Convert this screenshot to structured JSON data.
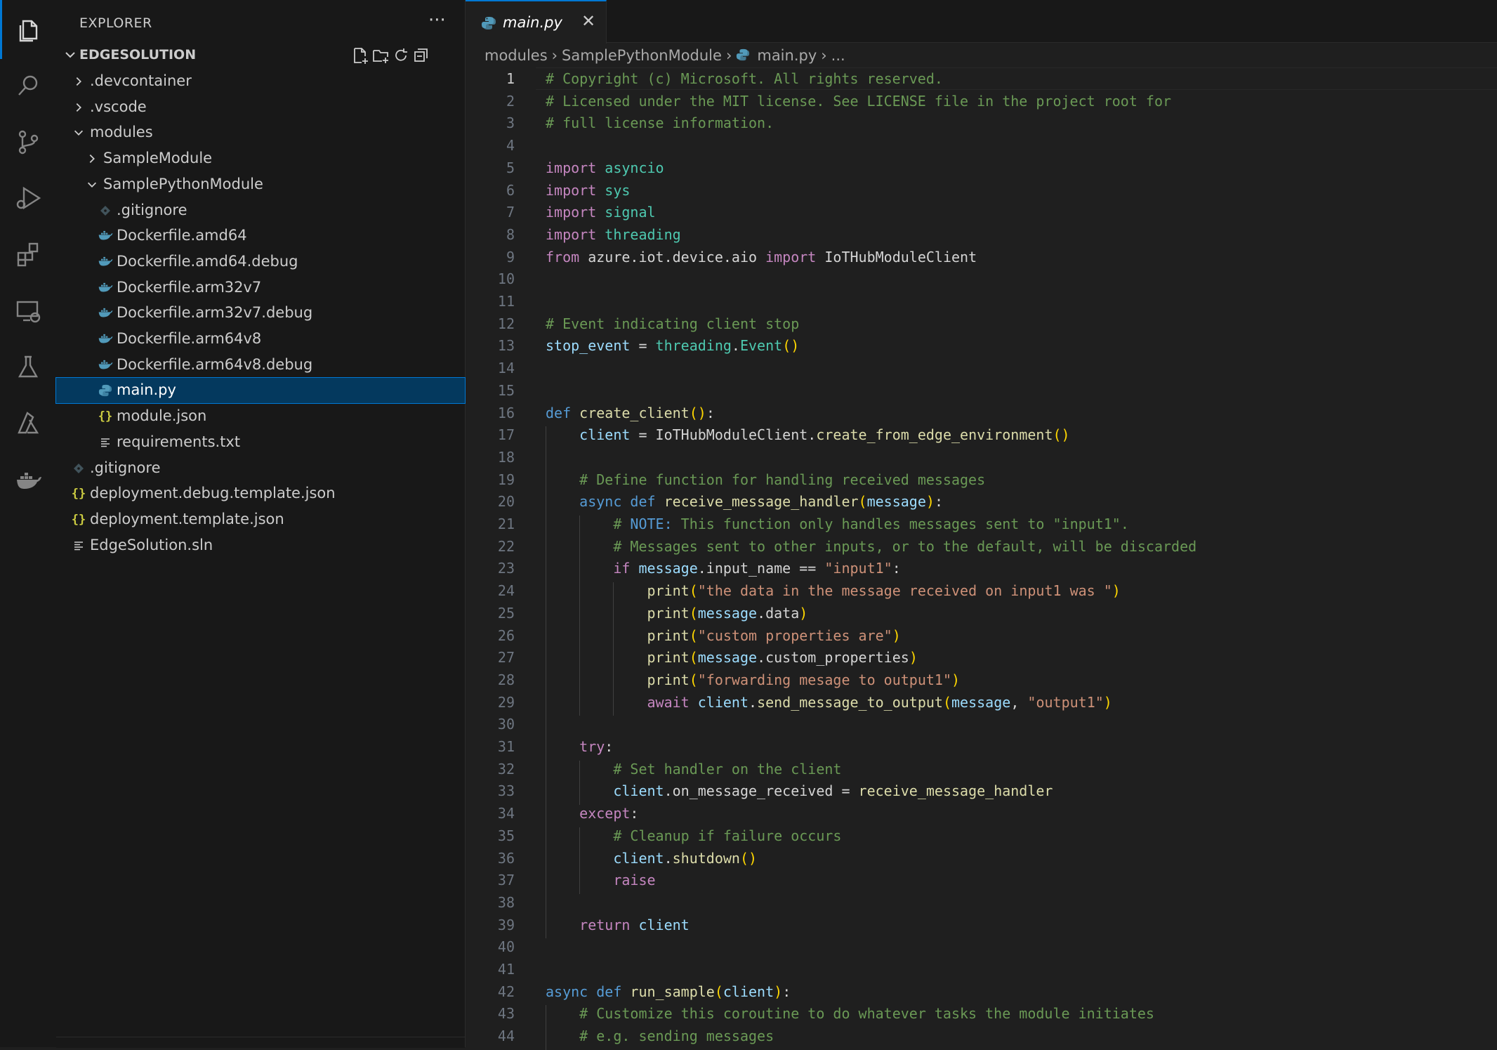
{
  "explorer": {
    "header": "EXPLORER",
    "more": "···",
    "section_title": "EDGESOLUTION",
    "section_actions": [
      "new-file",
      "new-folder",
      "refresh",
      "collapse-all"
    ],
    "tree": [
      {
        "label": ".devcontainer",
        "type": "folder",
        "expanded": false,
        "depth": 1
      },
      {
        "label": ".vscode",
        "type": "folder",
        "expanded": false,
        "depth": 1
      },
      {
        "label": "modules",
        "type": "folder",
        "expanded": true,
        "depth": 1
      },
      {
        "label": "SampleModule",
        "type": "folder",
        "expanded": false,
        "depth": 2
      },
      {
        "label": "SamplePythonModule",
        "type": "folder",
        "expanded": true,
        "depth": 2
      },
      {
        "label": ".gitignore",
        "type": "git",
        "depth": 3
      },
      {
        "label": "Dockerfile.amd64",
        "type": "docker",
        "depth": 3
      },
      {
        "label": "Dockerfile.amd64.debug",
        "type": "docker",
        "depth": 3
      },
      {
        "label": "Dockerfile.arm32v7",
        "type": "docker",
        "depth": 3
      },
      {
        "label": "Dockerfile.arm32v7.debug",
        "type": "docker",
        "depth": 3
      },
      {
        "label": "Dockerfile.arm64v8",
        "type": "docker",
        "depth": 3
      },
      {
        "label": "Dockerfile.arm64v8.debug",
        "type": "docker",
        "depth": 3
      },
      {
        "label": "main.py",
        "type": "python",
        "depth": 3,
        "selected": true
      },
      {
        "label": "module.json",
        "type": "json",
        "depth": 3
      },
      {
        "label": "requirements.txt",
        "type": "text",
        "depth": 3
      },
      {
        "label": ".gitignore",
        "type": "git",
        "depth": 1
      },
      {
        "label": "deployment.debug.template.json",
        "type": "json",
        "depth": 1
      },
      {
        "label": "deployment.template.json",
        "type": "json",
        "depth": 1
      },
      {
        "label": "EdgeSolution.sln",
        "type": "text",
        "depth": 1
      }
    ]
  },
  "activity_bar": [
    "explorer-icon",
    "search-icon",
    "source-control-icon",
    "run-debug-icon",
    "extensions-icon",
    "remote-explorer-icon",
    "testing-icon",
    "azure-icon",
    "docker-icon"
  ],
  "tab": {
    "label": "main.py",
    "close": "✕"
  },
  "breadcrumbs": [
    "modules",
    "SamplePythonModule",
    "main.py",
    "..."
  ],
  "editor": {
    "current_line": 1,
    "lines": [
      {
        "n": "1",
        "t": [
          [
            "c-com",
            "# Copyright (c) Microsoft. All rights reserved."
          ]
        ]
      },
      {
        "n": "2",
        "t": [
          [
            "c-com",
            "# Licensed under the MIT license. See LICENSE file in the project root for"
          ]
        ]
      },
      {
        "n": "3",
        "t": [
          [
            "c-com",
            "# full license information."
          ]
        ]
      },
      {
        "n": "4",
        "t": []
      },
      {
        "n": "5",
        "t": [
          [
            "c-kw",
            "import"
          ],
          [
            "c-txt",
            " "
          ],
          [
            "c-mod",
            "asyncio"
          ]
        ]
      },
      {
        "n": "6",
        "t": [
          [
            "c-kw",
            "import"
          ],
          [
            "c-txt",
            " "
          ],
          [
            "c-mod",
            "sys"
          ]
        ]
      },
      {
        "n": "7",
        "t": [
          [
            "c-kw",
            "import"
          ],
          [
            "c-txt",
            " "
          ],
          [
            "c-mod",
            "signal"
          ]
        ]
      },
      {
        "n": "8",
        "t": [
          [
            "c-kw",
            "import"
          ],
          [
            "c-txt",
            " "
          ],
          [
            "c-mod",
            "threading"
          ]
        ]
      },
      {
        "n": "9",
        "t": [
          [
            "c-kw",
            "from"
          ],
          [
            "c-txt",
            " azure.iot.device.aio "
          ],
          [
            "c-kw",
            "import"
          ],
          [
            "c-txt",
            " IoTHubModuleClient"
          ]
        ]
      },
      {
        "n": "10",
        "t": []
      },
      {
        "n": "11",
        "t": []
      },
      {
        "n": "12",
        "t": [
          [
            "c-com",
            "# Event indicating client stop"
          ]
        ]
      },
      {
        "n": "13",
        "t": [
          [
            "c-var",
            "stop_event"
          ],
          [
            "c-txt",
            " = "
          ],
          [
            "c-mod",
            "threading"
          ],
          [
            "c-txt",
            "."
          ],
          [
            "c-mod",
            "Event"
          ],
          [
            "c-p1",
            "()"
          ]
        ]
      },
      {
        "n": "14",
        "t": []
      },
      {
        "n": "15",
        "t": []
      },
      {
        "n": "16",
        "t": [
          [
            "c-def",
            "def"
          ],
          [
            "c-txt",
            " "
          ],
          [
            "c-fn",
            "create_client"
          ],
          [
            "c-p1",
            "()"
          ],
          [
            "c-txt",
            ":"
          ]
        ]
      },
      {
        "n": "17",
        "t": [
          [
            "c-txt",
            "    "
          ],
          [
            "c-var",
            "client"
          ],
          [
            "c-txt",
            " = "
          ],
          [
            "c-txt",
            "IoTHubModuleClient"
          ],
          [
            "c-txt",
            "."
          ],
          [
            "c-fn",
            "create_from_edge_environment"
          ],
          [
            "c-p1",
            "()"
          ]
        ]
      },
      {
        "n": "18",
        "t": []
      },
      {
        "n": "19",
        "t": [
          [
            "c-txt",
            "    "
          ],
          [
            "c-com",
            "# Define function for handling received messages"
          ]
        ]
      },
      {
        "n": "20",
        "t": [
          [
            "c-txt",
            "    "
          ],
          [
            "c-def",
            "async def"
          ],
          [
            "c-txt",
            " "
          ],
          [
            "c-fn",
            "receive_message_handler"
          ],
          [
            "c-p1",
            "("
          ],
          [
            "c-var",
            "message"
          ],
          [
            "c-p1",
            ")"
          ],
          [
            "c-txt",
            ":"
          ]
        ]
      },
      {
        "n": "21",
        "t": [
          [
            "c-txt",
            "        "
          ],
          [
            "c-com",
            "# "
          ],
          [
            "c-def",
            "NOTE:"
          ],
          [
            "c-com",
            " This function only handles messages sent to \"input1\"."
          ]
        ]
      },
      {
        "n": "22",
        "t": [
          [
            "c-txt",
            "        "
          ],
          [
            "c-com",
            "# Messages sent to other inputs, or to the default, will be discarded"
          ]
        ]
      },
      {
        "n": "23",
        "t": [
          [
            "c-txt",
            "        "
          ],
          [
            "c-kw",
            "if"
          ],
          [
            "c-txt",
            " "
          ],
          [
            "c-var",
            "message"
          ],
          [
            "c-txt",
            ".input_name == "
          ],
          [
            "c-str",
            "\"input1\""
          ],
          [
            "c-txt",
            ":"
          ]
        ]
      },
      {
        "n": "24",
        "t": [
          [
            "c-txt",
            "            "
          ],
          [
            "c-fn",
            "print"
          ],
          [
            "c-p1",
            "("
          ],
          [
            "c-str",
            "\"the data in the message received on input1 was \""
          ],
          [
            "c-p1",
            ")"
          ]
        ]
      },
      {
        "n": "25",
        "t": [
          [
            "c-txt",
            "            "
          ],
          [
            "c-fn",
            "print"
          ],
          [
            "c-p1",
            "("
          ],
          [
            "c-var",
            "message"
          ],
          [
            "c-txt",
            ".data"
          ],
          [
            "c-p1",
            ")"
          ]
        ]
      },
      {
        "n": "26",
        "t": [
          [
            "c-txt",
            "            "
          ],
          [
            "c-fn",
            "print"
          ],
          [
            "c-p1",
            "("
          ],
          [
            "c-str",
            "\"custom properties are\""
          ],
          [
            "c-p1",
            ")"
          ]
        ]
      },
      {
        "n": "27",
        "t": [
          [
            "c-txt",
            "            "
          ],
          [
            "c-fn",
            "print"
          ],
          [
            "c-p1",
            "("
          ],
          [
            "c-var",
            "message"
          ],
          [
            "c-txt",
            ".custom_properties"
          ],
          [
            "c-p1",
            ")"
          ]
        ]
      },
      {
        "n": "28",
        "t": [
          [
            "c-txt",
            "            "
          ],
          [
            "c-fn",
            "print"
          ],
          [
            "c-p1",
            "("
          ],
          [
            "c-str",
            "\"forwarding mesage to output1\""
          ],
          [
            "c-p1",
            ")"
          ]
        ]
      },
      {
        "n": "29",
        "t": [
          [
            "c-txt",
            "            "
          ],
          [
            "c-kw",
            "await"
          ],
          [
            "c-txt",
            " "
          ],
          [
            "c-var",
            "client"
          ],
          [
            "c-txt",
            "."
          ],
          [
            "c-fn",
            "send_message_to_output"
          ],
          [
            "c-p1",
            "("
          ],
          [
            "c-var",
            "message"
          ],
          [
            "c-txt",
            ", "
          ],
          [
            "c-str",
            "\"output1\""
          ],
          [
            "c-p1",
            ")"
          ]
        ]
      },
      {
        "n": "30",
        "t": []
      },
      {
        "n": "31",
        "t": [
          [
            "c-txt",
            "    "
          ],
          [
            "c-kw",
            "try"
          ],
          [
            "c-txt",
            ":"
          ]
        ]
      },
      {
        "n": "32",
        "t": [
          [
            "c-txt",
            "        "
          ],
          [
            "c-com",
            "# Set handler on the client"
          ]
        ]
      },
      {
        "n": "33",
        "t": [
          [
            "c-txt",
            "        "
          ],
          [
            "c-var",
            "client"
          ],
          [
            "c-txt",
            ".on_message_received = "
          ],
          [
            "c-fn",
            "receive_message_handler"
          ]
        ]
      },
      {
        "n": "34",
        "t": [
          [
            "c-txt",
            "    "
          ],
          [
            "c-kw",
            "except"
          ],
          [
            "c-txt",
            ":"
          ]
        ]
      },
      {
        "n": "35",
        "t": [
          [
            "c-txt",
            "        "
          ],
          [
            "c-com",
            "# Cleanup if failure occurs"
          ]
        ]
      },
      {
        "n": "36",
        "t": [
          [
            "c-txt",
            "        "
          ],
          [
            "c-var",
            "client"
          ],
          [
            "c-txt",
            "."
          ],
          [
            "c-fn",
            "shutdown"
          ],
          [
            "c-p1",
            "()"
          ]
        ]
      },
      {
        "n": "37",
        "t": [
          [
            "c-txt",
            "        "
          ],
          [
            "c-kw",
            "raise"
          ]
        ]
      },
      {
        "n": "38",
        "t": []
      },
      {
        "n": "39",
        "t": [
          [
            "c-txt",
            "    "
          ],
          [
            "c-kw",
            "return"
          ],
          [
            "c-txt",
            " "
          ],
          [
            "c-var",
            "client"
          ]
        ]
      },
      {
        "n": "40",
        "t": []
      },
      {
        "n": "41",
        "t": []
      },
      {
        "n": "42",
        "t": [
          [
            "c-def",
            "async def"
          ],
          [
            "c-txt",
            " "
          ],
          [
            "c-fn",
            "run_sample"
          ],
          [
            "c-p1",
            "("
          ],
          [
            "c-var",
            "client"
          ],
          [
            "c-p1",
            ")"
          ],
          [
            "c-txt",
            ":"
          ]
        ]
      },
      {
        "n": "43",
        "t": [
          [
            "c-txt",
            "    "
          ],
          [
            "c-com",
            "# Customize this coroutine to do whatever tasks the module initiates"
          ]
        ]
      },
      {
        "n": "44",
        "t": [
          [
            "c-txt",
            "    "
          ],
          [
            "c-com",
            "# e.g. sending messages"
          ]
        ]
      }
    ]
  }
}
